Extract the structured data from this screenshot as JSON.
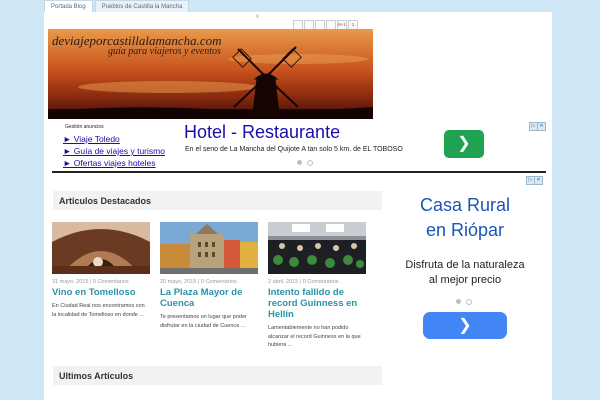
{
  "tabs": [
    "Portada Blog",
    "Pueblos de Castilla la Mancha"
  ],
  "close_mark": "x",
  "social_buttons": [
    "",
    "",
    "",
    "",
    "8+1",
    "1"
  ],
  "banner": {
    "title": "deviajeporcastillalamancha.com",
    "subtitle": "guía para viajeros y eventos"
  },
  "ad_top": {
    "label": "Gestión anuncios",
    "links": [
      "► Viaje Toledo",
      "► Guía de viajes y turismo",
      "► Ofertas viajes hoteles"
    ],
    "title": "Hotel - Restaurante",
    "description": "En el seno de La Mancha del Quijote A tan solo 5 km. de EL TOBOSO",
    "go_icon": "chevron-right-icon"
  },
  "featured": {
    "header": "Articulos Destacados",
    "posts": [
      {
        "meta": "31 mayo, 2015 | 0 Comentarios",
        "title": "Vino en Tomelloso",
        "excerpt": "En Ciudad Real nos encontramos con la localidad de Tomelloso en donde ..."
      },
      {
        "meta": "20 mayo, 2015 | 0 Comentarios",
        "title": "La Plaza Mayor de Cuenca",
        "excerpt": "Te presentamos un lugar que poder disfrutar en la ciudad de Cuenca ..."
      },
      {
        "meta": "2 abril, 2015 | 0 Comentarios",
        "title": "Intento fallido de record Guinness en Hellín",
        "excerpt": "Lamentablemente no han podido alcanzar el record Guinness en la que hubiera ..."
      }
    ]
  },
  "latest": {
    "header": "Ultimos Articulos"
  },
  "ad_side": {
    "title_line1": "Casa Rural",
    "title_line2": "en Riópar",
    "text_line1": "Disfruta de la naturaleza",
    "text_line2": "al mejor precio",
    "go_icon": "chevron-right-icon"
  },
  "colors": {
    "accent": "#2a94a8",
    "ad_blue": "#1a0dab",
    "go_green": "#1fa351",
    "go_blue": "#4285f4",
    "background": "#cfe6f4"
  }
}
